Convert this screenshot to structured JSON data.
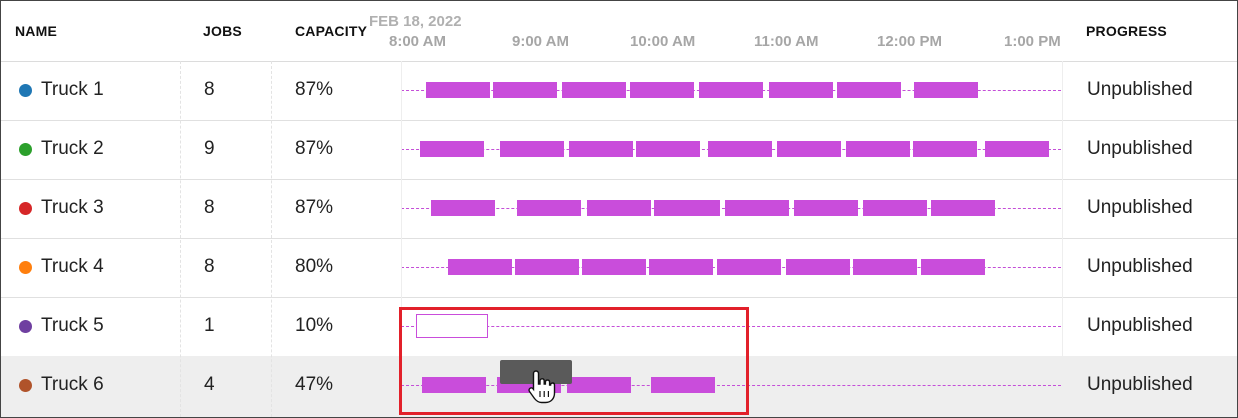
{
  "header": {
    "name_label": "NAME",
    "jobs_label": "JOBS",
    "capacity_label": "CAPACITY",
    "progress_label": "PROGRESS",
    "date": "FEB 18, 2022",
    "times": [
      "8:00 AM",
      "9:00 AM",
      "10:00 AM",
      "11:00 AM",
      "12:00 PM",
      "1:00 PM"
    ]
  },
  "rows": [
    {
      "name": "Truck 1",
      "color": "#1f77b4",
      "jobs": "8",
      "capacity": "87%",
      "progress": "Unpublished"
    },
    {
      "name": "Truck 2",
      "color": "#2ca02c",
      "jobs": "9",
      "capacity": "87%",
      "progress": "Unpublished"
    },
    {
      "name": "Truck 3",
      "color": "#d62728",
      "jobs": "8",
      "capacity": "87%",
      "progress": "Unpublished"
    },
    {
      "name": "Truck 4",
      "color": "#ff7f0e",
      "jobs": "8",
      "capacity": "80%",
      "progress": "Unpublished"
    },
    {
      "name": "Truck 5",
      "color": "#6f3fa0",
      "jobs": "1",
      "capacity": "10%",
      "progress": "Unpublished"
    },
    {
      "name": "Truck 6",
      "color": "#b0532a",
      "jobs": "4",
      "capacity": "47%",
      "progress": "Unpublished"
    }
  ],
  "colors": {
    "job_bar": "#c94ddb",
    "highlight": "#e2202a",
    "drag_ghost": "#5a5a5a"
  },
  "icons": {
    "cursor": "hand-pointer-icon"
  }
}
